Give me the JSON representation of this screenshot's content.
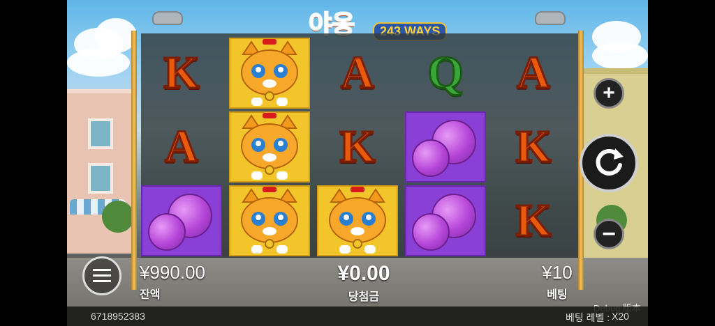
{
  "title": {
    "korean": "야옹",
    "ways": "243 WAYS"
  },
  "reels": {
    "row1": [
      "K",
      "cat",
      "A",
      "Q",
      "A"
    ],
    "row2": [
      "A",
      "cat",
      "K",
      "yarn",
      "K"
    ],
    "row3": [
      "yarn",
      "cat",
      "cat",
      "yarn",
      "K"
    ]
  },
  "balance": {
    "value": "¥990.00",
    "label": "잔액"
  },
  "win": {
    "value": "¥0.00",
    "label": "당첨금"
  },
  "bet": {
    "value": "¥10",
    "label": "베팅"
  },
  "session_id": "6718952383",
  "debug_label": "Debug 版本",
  "bet_level": {
    "label": "베팅 레벨 :",
    "value": "X20"
  },
  "icons": {
    "menu": "menu-icon",
    "plus": "plus-icon",
    "minus": "minus-icon",
    "spin": "spin-icon"
  }
}
